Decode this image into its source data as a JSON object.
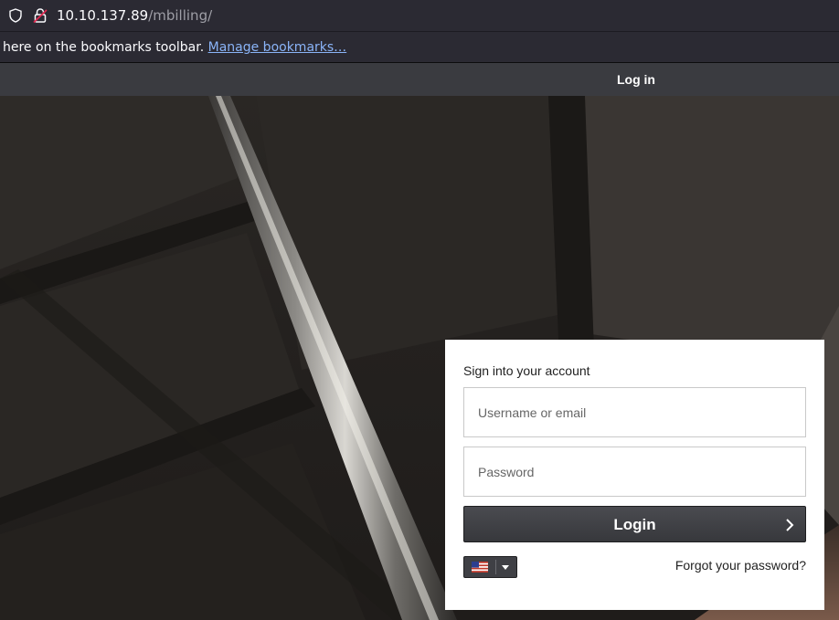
{
  "browser": {
    "url_host": "10.10.137.89",
    "url_path": "/mbilling/",
    "bookmarks_message": "here on the bookmarks toolbar.",
    "manage_bookmarks_label": "Manage bookmarks…"
  },
  "nav": {
    "login_link": "Log in"
  },
  "login_form": {
    "heading": "Sign into your account",
    "username_placeholder": "Username or email",
    "password_placeholder": "Password",
    "submit_label": "Login",
    "language_icon": "us-flag-icon",
    "forgot_password_label": "Forgot your password?"
  },
  "colors": {
    "nav_bar": "#3a3b40",
    "button": "#3c3d42",
    "link": "#8ab4f8"
  }
}
